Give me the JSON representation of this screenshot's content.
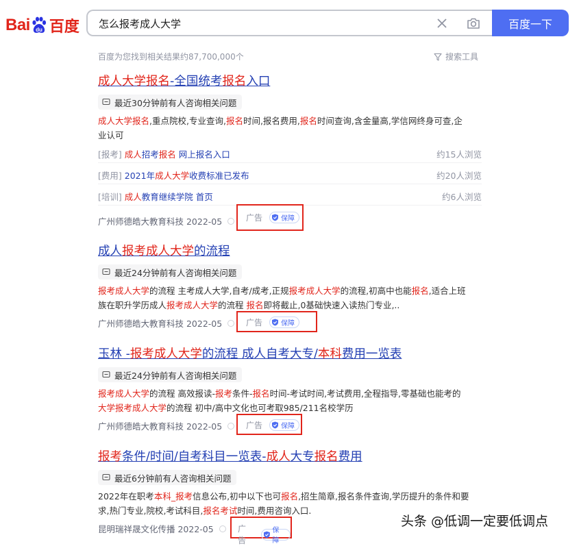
{
  "logo": {
    "bai": "Bai",
    "du": "du",
    "cn": "百度"
  },
  "search": {
    "query": "怎么报考成人大学",
    "button_label": "百度一下"
  },
  "stats": {
    "result_count": "百度为您找到相关结果约87,700,000个",
    "tools_label": "搜索工具"
  },
  "results": [
    {
      "title": [
        {
          "t": "成人大学报名",
          "red": true
        },
        {
          "t": "-全国统考",
          "red": false
        },
        {
          "t": "报名",
          "red": true
        },
        {
          "t": "入口",
          "red": false
        }
      ],
      "consult": "最近30分钟前有人咨询相关问题",
      "desc_lines": [
        [
          {
            "t": "成人大学报名",
            "red": true
          },
          {
            "t": ",重点院校,专业查询,",
            "red": false
          },
          {
            "t": "报名",
            "red": true
          },
          {
            "t": "时间,报名费用,",
            "red": false
          },
          {
            "t": "报名",
            "red": true
          },
          {
            "t": "时间查询,含金量高,学信网终身可查,企",
            "red": false
          }
        ],
        [
          {
            "t": "业认可",
            "red": false
          }
        ]
      ],
      "sublinks": [
        {
          "tag": "[报考]",
          "parts": [
            {
              "t": "成人",
              "red": true
            },
            {
              "t": "招考",
              "red": false
            },
            {
              "t": "报名",
              "red": true
            },
            {
              "t": " 网上报名入口",
              "red": false
            }
          ],
          "views": "约15人浏览"
        },
        {
          "tag": "[费用]",
          "parts": [
            {
              "t": "2021年",
              "red": false
            },
            {
              "t": "成人大学",
              "red": true
            },
            {
              "t": "收费标准已发布",
              "red": false
            }
          ],
          "views": "约20人浏览"
        },
        {
          "tag": "[培训]",
          "parts": [
            {
              "t": "成人",
              "red": true
            },
            {
              "t": "教育继续学院 首页",
              "red": false
            }
          ],
          "views": "约6人浏览"
        }
      ],
      "source": "广州师德皓大教育科技 2022-05",
      "ad": "广告",
      "guarantee": "保障"
    },
    {
      "title": [
        {
          "t": "成人",
          "red": false
        },
        {
          "t": "报考成人大学",
          "red": true
        },
        {
          "t": "的流程",
          "red": false
        }
      ],
      "consult": "最近24分钟前有人咨询相关问题",
      "desc_lines": [
        [
          {
            "t": "报考成人大学",
            "red": true
          },
          {
            "t": "的流程 主考成人大学,自考/成考,正规",
            "red": false
          },
          {
            "t": "报考成人大学",
            "red": true
          },
          {
            "t": "的流程,初高中也能",
            "red": false
          },
          {
            "t": "报名",
            "red": true
          },
          {
            "t": ",适合上班",
            "red": false
          }
        ],
        [
          {
            "t": "族在职升学历成人",
            "red": false
          },
          {
            "t": "报考成人大学",
            "red": true
          },
          {
            "t": "的流程 ",
            "red": false
          },
          {
            "t": "报名",
            "red": true
          },
          {
            "t": "即将截止,0基础快速入读热门专业,..",
            "red": false
          }
        ]
      ],
      "source": "广州师德皓大教育科技 2022-05",
      "ad": "广告",
      "guarantee": "保障"
    },
    {
      "title": [
        {
          "t": "玉林 -",
          "red": false
        },
        {
          "t": "报考成人大学",
          "red": true
        },
        {
          "t": "的流程 成人自考大专/",
          "red": false
        },
        {
          "t": "本科",
          "red": true
        },
        {
          "t": "费用一览表",
          "red": false
        }
      ],
      "consult": "最近24分钟前有人咨询相关问题",
      "desc_lines": [
        [
          {
            "t": "报考成人大学",
            "red": true
          },
          {
            "t": "的流程 高效报读-",
            "red": false
          },
          {
            "t": "报考",
            "red": true
          },
          {
            "t": "条件-",
            "red": false
          },
          {
            "t": "报名",
            "red": true
          },
          {
            "t": "时间-考试时间,考试费用,全程指导,零基础也能考的",
            "red": false
          }
        ],
        [
          {
            "t": "大学报考成人大学",
            "red": true
          },
          {
            "t": "的流程 初中/高中文化也可考取985/211名校学历",
            "red": false
          }
        ]
      ],
      "source": "广州师德皓大教育科技 2022-05",
      "ad": "广告",
      "guarantee": "保障"
    },
    {
      "title": [
        {
          "t": "报考",
          "red": true
        },
        {
          "t": "条件/时间/自考科目一览表-",
          "red": false
        },
        {
          "t": "成人",
          "red": true
        },
        {
          "t": "大专",
          "red": false
        },
        {
          "t": "报名",
          "red": true
        },
        {
          "t": "费用",
          "red": false
        }
      ],
      "consult": "最近6分钟前有人咨询相关问题",
      "desc_lines": [
        [
          {
            "t": "2022年在职考",
            "red": false
          },
          {
            "t": "本科_报考",
            "red": true
          },
          {
            "t": "信息公布,初中以下也可",
            "red": false
          },
          {
            "t": "报名",
            "red": true
          },
          {
            "t": ",招生简章,报名条件查询,学历提升的条件和要",
            "red": false
          }
        ],
        [
          {
            "t": "求,热门专业,院校,考试科目,",
            "red": false
          },
          {
            "t": "报名考试",
            "red": true
          },
          {
            "t": "时间,费用咨询入口.",
            "red": false
          }
        ]
      ],
      "source": "昆明瑞祥晟文化传播 2022-05",
      "ad": "广告",
      "guarantee": "保障"
    }
  ],
  "watermark": "头条 @低调一定要低调点",
  "colors": {
    "link": "#2440b3",
    "highlight": "#e1251b",
    "button": "#4e6ef2",
    "annotation_box": "#e1251b"
  }
}
